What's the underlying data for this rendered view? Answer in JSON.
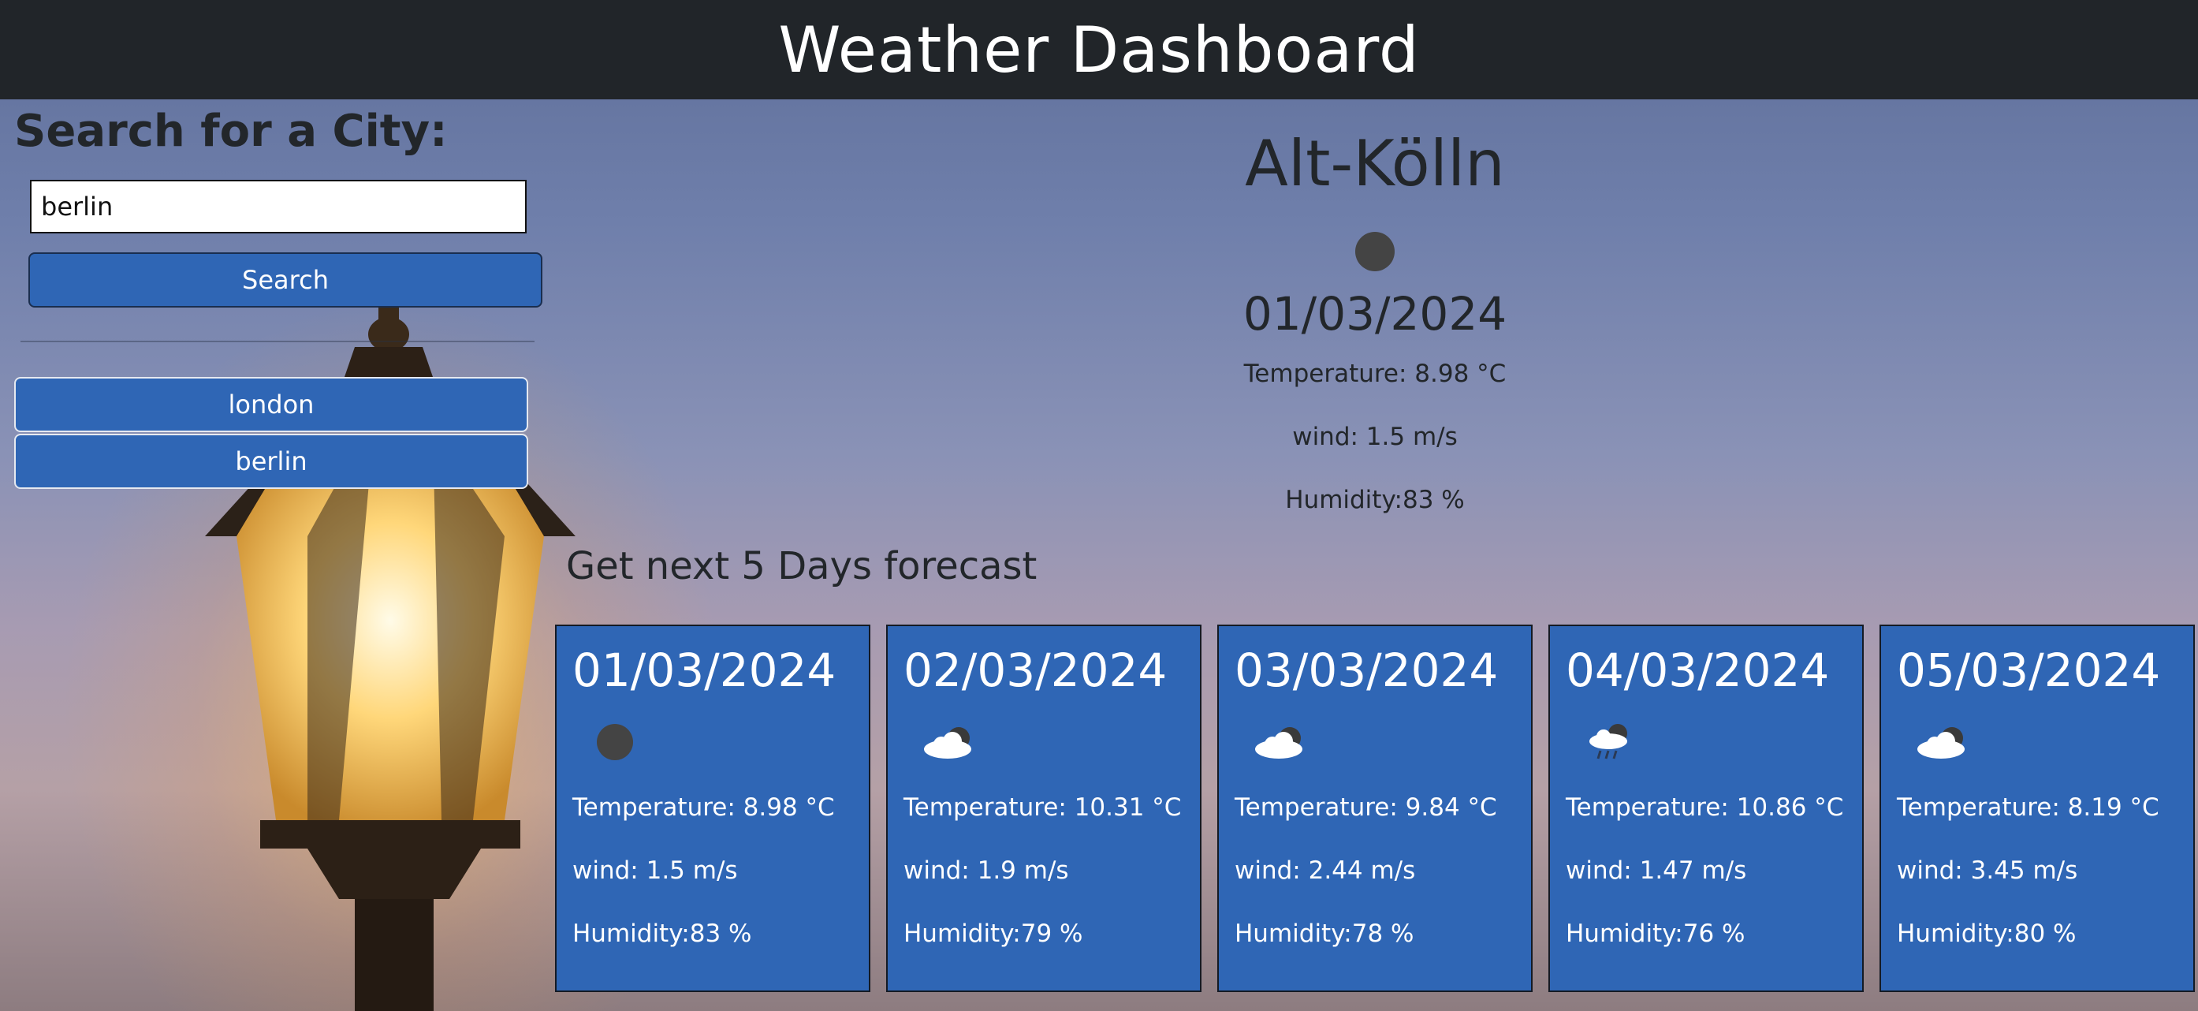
{
  "header": {
    "title": "Weather Dashboard"
  },
  "sidebar": {
    "title": "Search for a City:",
    "search_value": "berlin",
    "search_button": "Search",
    "history": [
      "london",
      "berlin"
    ]
  },
  "current": {
    "city": "Alt-Kölln",
    "icon": "moon-icon",
    "date": "01/03/2024",
    "temperature": "Temperature: 8.98 °C",
    "wind": "wind: 1.5 m/s",
    "humidity": "Humidity:83 %"
  },
  "forecast": {
    "heading": "Get next 5 Days forecast",
    "days": [
      {
        "date": "01/03/2024",
        "icon": "moon-icon",
        "temperature": "Temperature: 8.98 °C",
        "wind": "wind: 1.5 m/s",
        "humidity": "Humidity:83 %"
      },
      {
        "date": "02/03/2024",
        "icon": "cloudy-night-icon",
        "temperature": "Temperature: 10.31 °C",
        "wind": "wind: 1.9 m/s",
        "humidity": "Humidity:79 %"
      },
      {
        "date": "03/03/2024",
        "icon": "cloudy-night-icon",
        "temperature": "Temperature: 9.84 °C",
        "wind": "wind: 2.44 m/s",
        "humidity": "Humidity:78 %"
      },
      {
        "date": "04/03/2024",
        "icon": "rain-cloud-icon",
        "temperature": "Temperature: 10.86 °C",
        "wind": "wind: 1.47 m/s",
        "humidity": "Humidity:76 %"
      },
      {
        "date": "05/03/2024",
        "icon": "cloudy-night-icon",
        "temperature": "Temperature: 8.19 °C",
        "wind": "wind: 3.45 m/s",
        "humidity": "Humidity:80 %"
      }
    ]
  },
  "colors": {
    "header_bg": "#212529",
    "accent": "#2f66b5"
  }
}
